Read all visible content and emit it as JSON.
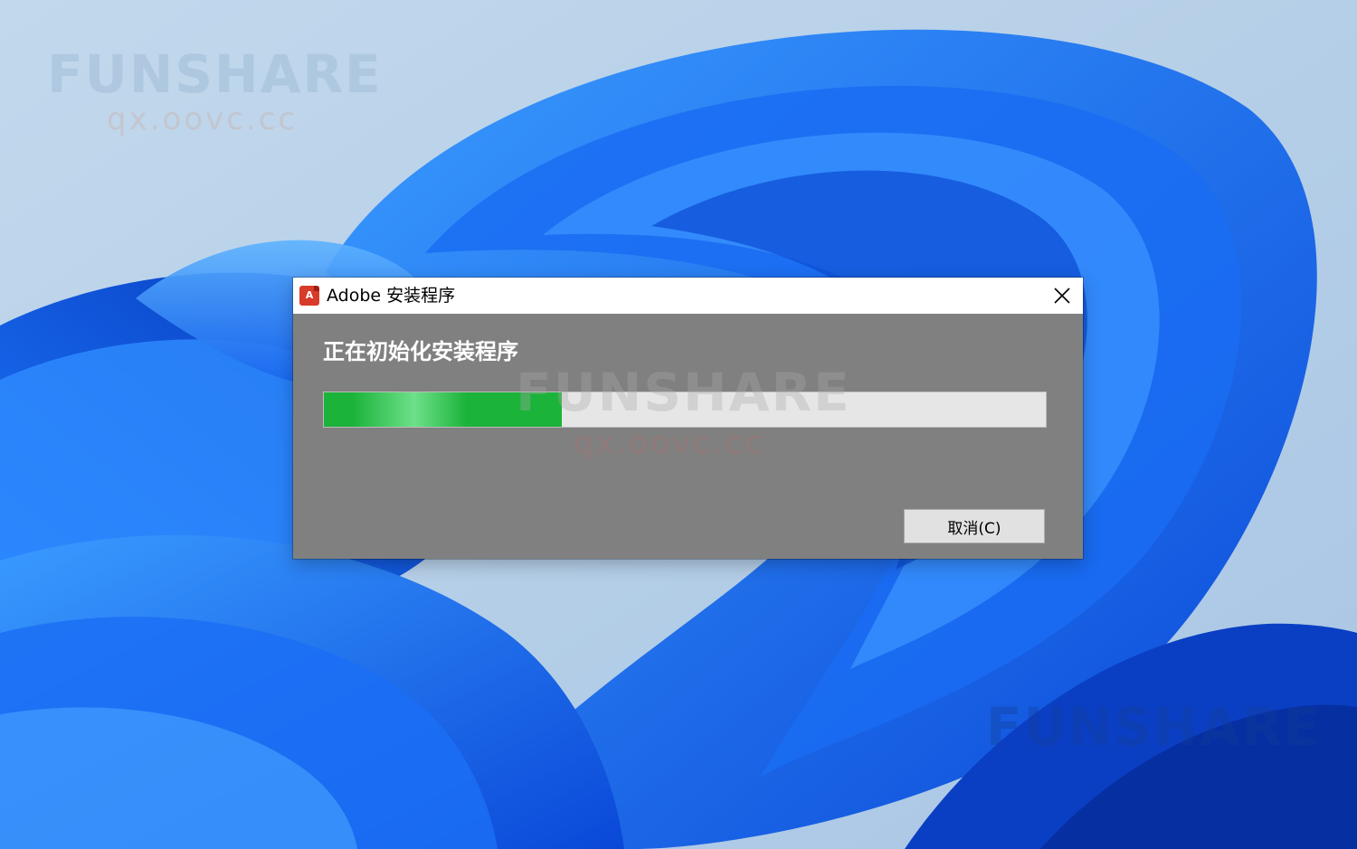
{
  "watermark": {
    "brand": "FUNSHARE",
    "url": "qx.oovc.cc"
  },
  "dialog": {
    "title": "Adobe 安装程序",
    "app_icon_glyph": "A",
    "close_icon": "close-icon",
    "status": "正在初始化安装程序",
    "progress_fraction": 0.33,
    "cancel_label": "取消(C)"
  },
  "colors": {
    "progress_green": "#1bb33a",
    "dialog_body": "#808080",
    "wallpaper_blue": "#1a5fe0"
  }
}
